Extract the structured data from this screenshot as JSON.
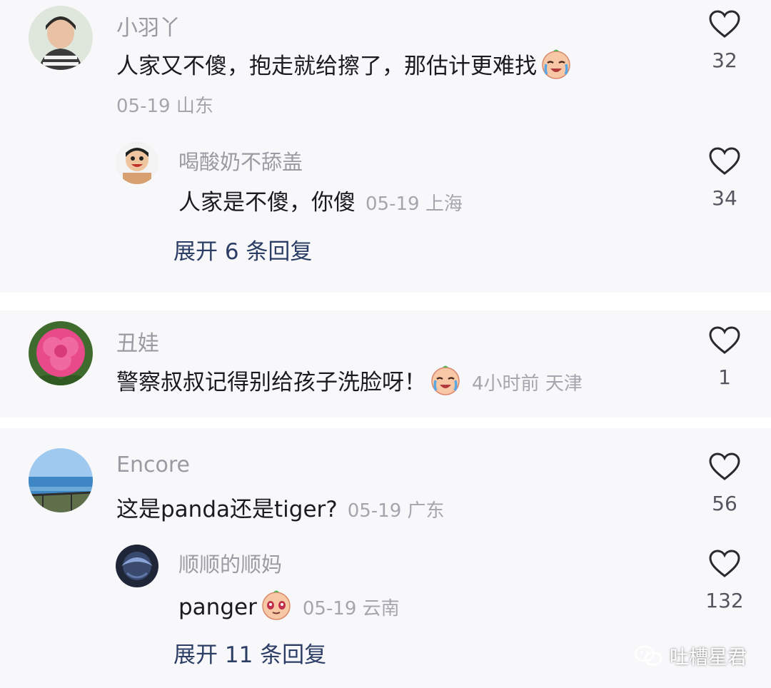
{
  "comments": [
    {
      "author": "小羽丫",
      "text": "人家又不傻，抱走就给擦了，那估计更难找",
      "emoji": "crying-face-emoji",
      "date": "05-19",
      "location": "山东",
      "likes": "32",
      "replies": [
        {
          "author": "喝酸奶不舔盖",
          "text": "人家是不傻，你傻",
          "date": "05-19",
          "location": "上海",
          "likes": "34"
        }
      ],
      "expand": "展开 6 条回复"
    },
    {
      "author": "丑娃",
      "text": "警察叔叔记得别给孩子洗脸呀！",
      "emoji": "crying-face-emoji",
      "time": "4小时前",
      "location": "天津",
      "likes": "1"
    },
    {
      "author": "Encore",
      "text": "这是panda还是tiger?",
      "date": "05-19",
      "location": "广东",
      "likes": "56",
      "replies": [
        {
          "author": "顺顺的顺妈",
          "text": "panger",
          "emoji": "shy-face-emoji",
          "date": "05-19",
          "location": "云南",
          "likes": "132"
        }
      ],
      "expand": "展开 11 条回复"
    }
  ],
  "watermark": {
    "text": "吐槽星君",
    "icon": "wechat-icon"
  },
  "colors": {
    "background": "#f8f8fa",
    "username": "#9a9aa2",
    "expand_link": "#2c3e65",
    "meta": "#a5a5ad"
  }
}
